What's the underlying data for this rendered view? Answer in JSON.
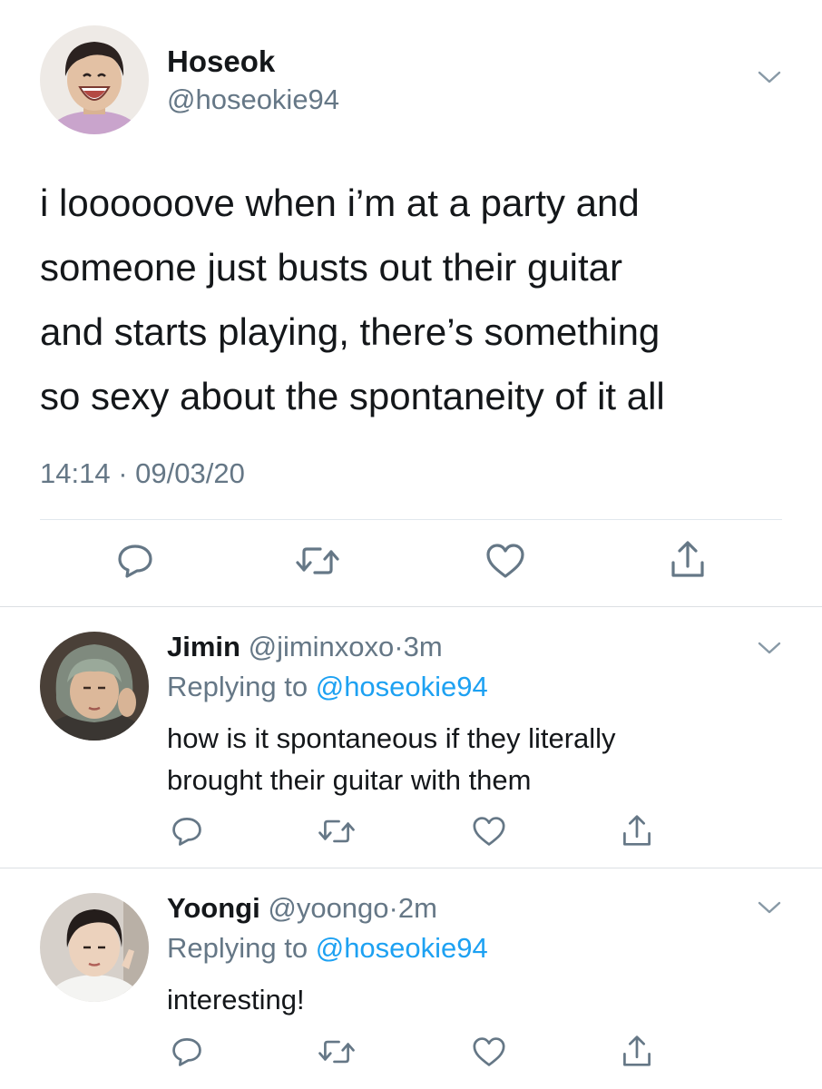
{
  "main_tweet": {
    "author_name": "Hoseok",
    "author_handle": "@hoseokie94",
    "text": "i loooooove when i’m at a party and\nsomeone just busts out their guitar\nand starts playing, there’s something\nso sexy about the spontaneity of it all",
    "time": "14:14",
    "separator": "·",
    "date": "09/03/20",
    "actions": [
      "reply-icon",
      "retweet-icon",
      "like-icon",
      "share-icon"
    ]
  },
  "replies": [
    {
      "author_name": "Jimin",
      "author_handle": "@jiminxoxo",
      "separator": "·",
      "time": "3m",
      "replying_prefix": "Replying to ",
      "replying_to": "@hoseokie94",
      "text": "how is it spontaneous if they literally\nbrought their guitar with them",
      "actions": [
        "reply-icon",
        "retweet-icon",
        "like-icon",
        "share-icon"
      ]
    },
    {
      "author_name": "Yoongi",
      "author_handle": "@yoongo",
      "separator": "·",
      "time": "2m",
      "replying_prefix": "Replying to ",
      "replying_to": "@hoseokie94",
      "text": "interesting!",
      "actions": [
        "reply-icon",
        "retweet-icon",
        "like-icon",
        "share-icon"
      ]
    }
  ],
  "colors": {
    "text": "#14171a",
    "secondary": "#657786",
    "link": "#1da1f2",
    "divider": "#e1e8ed"
  }
}
